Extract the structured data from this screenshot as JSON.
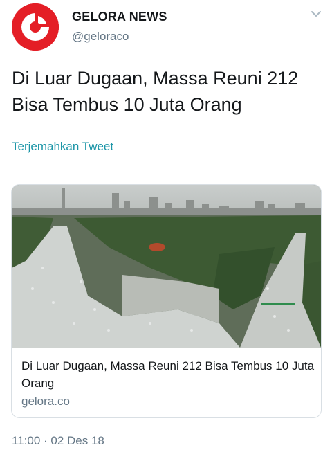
{
  "account": {
    "name": "GELORA NEWS",
    "handle": "@geloraco",
    "brand_color": "#e41e26",
    "avatar_icon": "gelora-logo-icon"
  },
  "menu_icon": "chevron-down-icon",
  "tweet": {
    "text": "Di Luar Dugaan, Massa Reuni 212 Bisa Tembus 10 Juta Orang",
    "translate_label": "Terjemahkan Tweet",
    "timestamp": "11:00 · 02 Des 18"
  },
  "card": {
    "title": "Di Luar Dugaan, Massa Reuni 212 Bisa Tembus 10 Juta Orang",
    "domain": "gelora.co",
    "image_description_icon": "crowd-photo"
  },
  "colors": {
    "text": "#14171a",
    "secondary": "#657786",
    "link": "#1b95a7",
    "border": "#d9dfe4"
  }
}
